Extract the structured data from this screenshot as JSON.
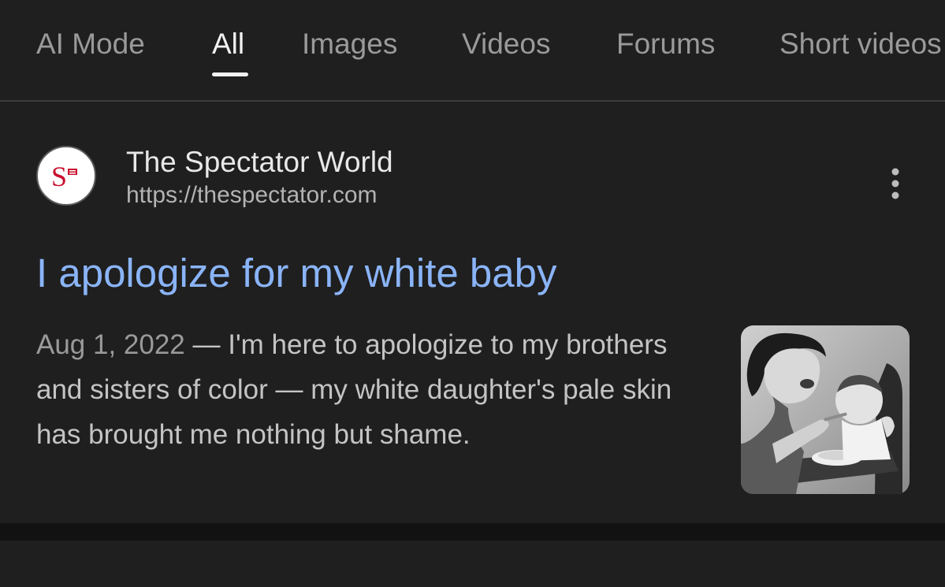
{
  "tabs": [
    {
      "label": "AI Mode",
      "active": false
    },
    {
      "label": "All",
      "active": true
    },
    {
      "label": "Images",
      "active": false
    },
    {
      "label": "Videos",
      "active": false
    },
    {
      "label": "Forums",
      "active": false
    },
    {
      "label": "Short videos",
      "active": false
    }
  ],
  "result": {
    "site_name": "The Spectator World",
    "url": "https://thespectator.com",
    "favicon_icon": "spectator-s-logo",
    "title": "I apologize for my white baby",
    "date": "Aug 1, 2022",
    "snippet": "I'm here to apologize to my brothers and sisters of color — my white daughter's pale skin has brought me nothing but shame.",
    "more_icon": "more-vertical-icon",
    "thumbnail_icon": "mother-feeding-baby-photo"
  },
  "colors": {
    "background": "#1f1f1f",
    "title_link": "#8ab4f8",
    "active_tab": "#f1f1f1",
    "inactive_tab": "#9a9a9a"
  }
}
